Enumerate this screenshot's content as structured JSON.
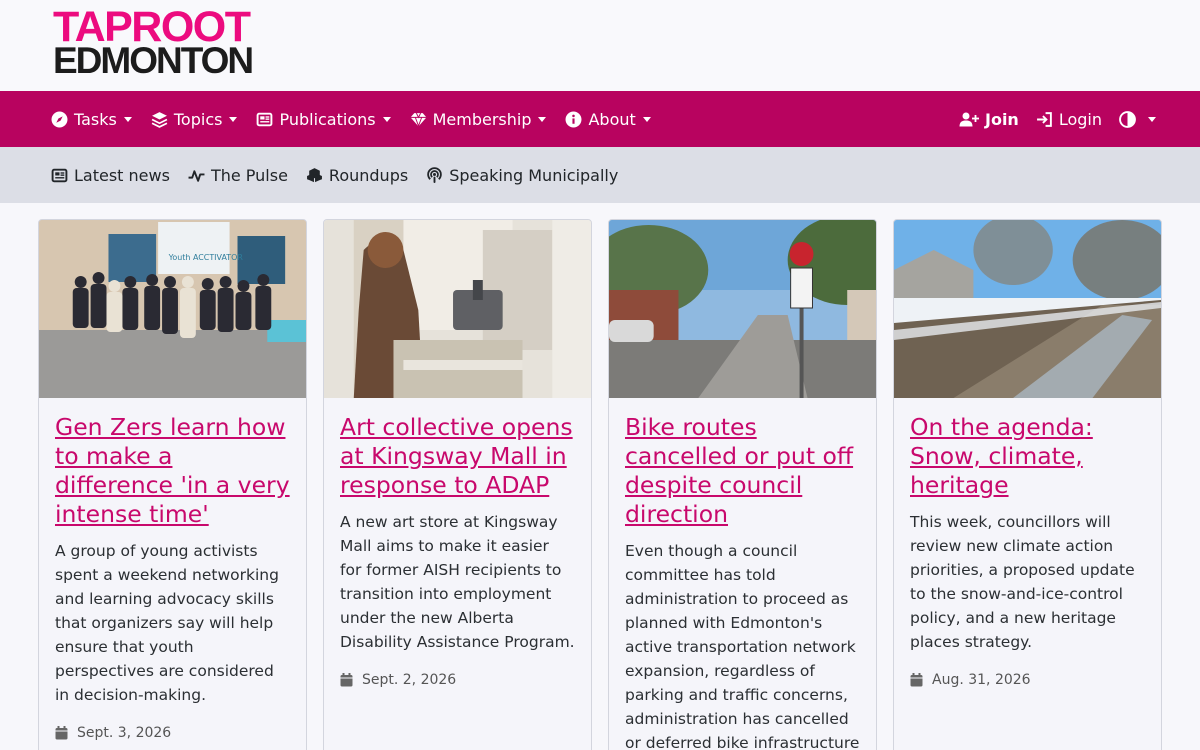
{
  "logo": {
    "line1": "TAPROOT",
    "line2": "EDMONTON"
  },
  "mainnav": {
    "items": [
      {
        "label": "Tasks",
        "icon": "compass-icon"
      },
      {
        "label": "Topics",
        "icon": "layers-icon"
      },
      {
        "label": "Publications",
        "icon": "newspaper-icon"
      },
      {
        "label": "Membership",
        "icon": "gem-icon"
      },
      {
        "label": "About",
        "icon": "info-icon"
      }
    ],
    "join": "Join",
    "login": "Login"
  },
  "subnav": {
    "items": [
      {
        "label": "Latest news",
        "icon": "newspaper-icon"
      },
      {
        "label": "The Pulse",
        "icon": "pulse-icon"
      },
      {
        "label": "Roundups",
        "icon": "cubes-icon"
      },
      {
        "label": "Speaking Municipally",
        "icon": "podcast-icon"
      }
    ]
  },
  "colors": {
    "brand": "#b8035f",
    "link": "#c8086c",
    "logo_pink": "#ec0b7f"
  },
  "cards": [
    {
      "title": "Gen Zers learn how to make a difference 'in a very intense time'",
      "summary": "A group of young activists spent a weekend networking and learning advocacy skills that organizers say will help ensure that youth perspectives are considered in decision-making.",
      "date": "Sept. 3, 2026",
      "image_text": "Youth ACCTIVATOR"
    },
    {
      "title": "Art collective opens at Kingsway Mall in response to ADAP",
      "summary": "A new art store at Kingsway Mall aims to make it easier for former AISH recipients to transition into employment under the new Alberta Disability Assistance Program.",
      "date": "Sept. 2, 2026"
    },
    {
      "title": "Bike routes cancelled or put off despite council direction",
      "summary": "Even though a council committee has told administration to proceed as planned with Edmonton's active transportation network expansion, regardless of parking and traffic concerns, administration has cancelled or deferred bike infrastructure",
      "date": ""
    },
    {
      "title": "On the agenda: Snow, climate, heritage",
      "summary": "This week, councillors will review new climate action priorities, a proposed update to the snow-and-ice-control policy, and a new heritage places strategy.",
      "date": "Aug. 31, 2026"
    }
  ]
}
